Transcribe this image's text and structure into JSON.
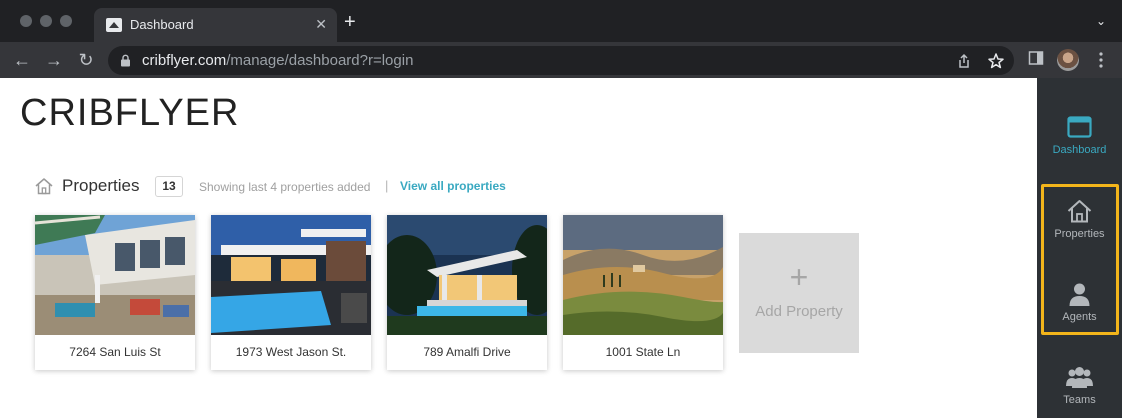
{
  "browser": {
    "tab_title": "Dashboard",
    "tab_close": "✕",
    "new_tab": "+",
    "tab_menu": "⌄",
    "url_host": "cribflyer.com",
    "url_path": "/manage/dashboard?r=login"
  },
  "brand": {
    "logo": "CRIBFLYER"
  },
  "properties_section": {
    "title": "Properties",
    "count": "13",
    "note": "Showing last 4 properties added",
    "separator": "|",
    "view_all": "View all properties"
  },
  "cards": [
    {
      "address": "7264 San Luis St",
      "image_icon": "patio-house-photo"
    },
    {
      "address": "1973 West Jason St.",
      "image_icon": "modern-pool-house-photo"
    },
    {
      "address": "789 Amalfi Drive",
      "image_icon": "villa-night-photo"
    },
    {
      "address": "1001 State Ln",
      "image_icon": "hills-landscape-photo"
    }
  ],
  "add_property": {
    "plus": "+",
    "label": "Add Property"
  },
  "sidebar": {
    "items": [
      {
        "label": "Dashboard",
        "icon": "window-icon"
      },
      {
        "label": "Properties",
        "icon": "home-icon"
      },
      {
        "label": "Agents",
        "icon": "person-icon"
      },
      {
        "label": "Teams",
        "icon": "people-icon"
      }
    ]
  },
  "colors": {
    "accent": "#3aa9c1",
    "highlight": "#f3b51b",
    "sidebar_bg": "#2d3135"
  }
}
